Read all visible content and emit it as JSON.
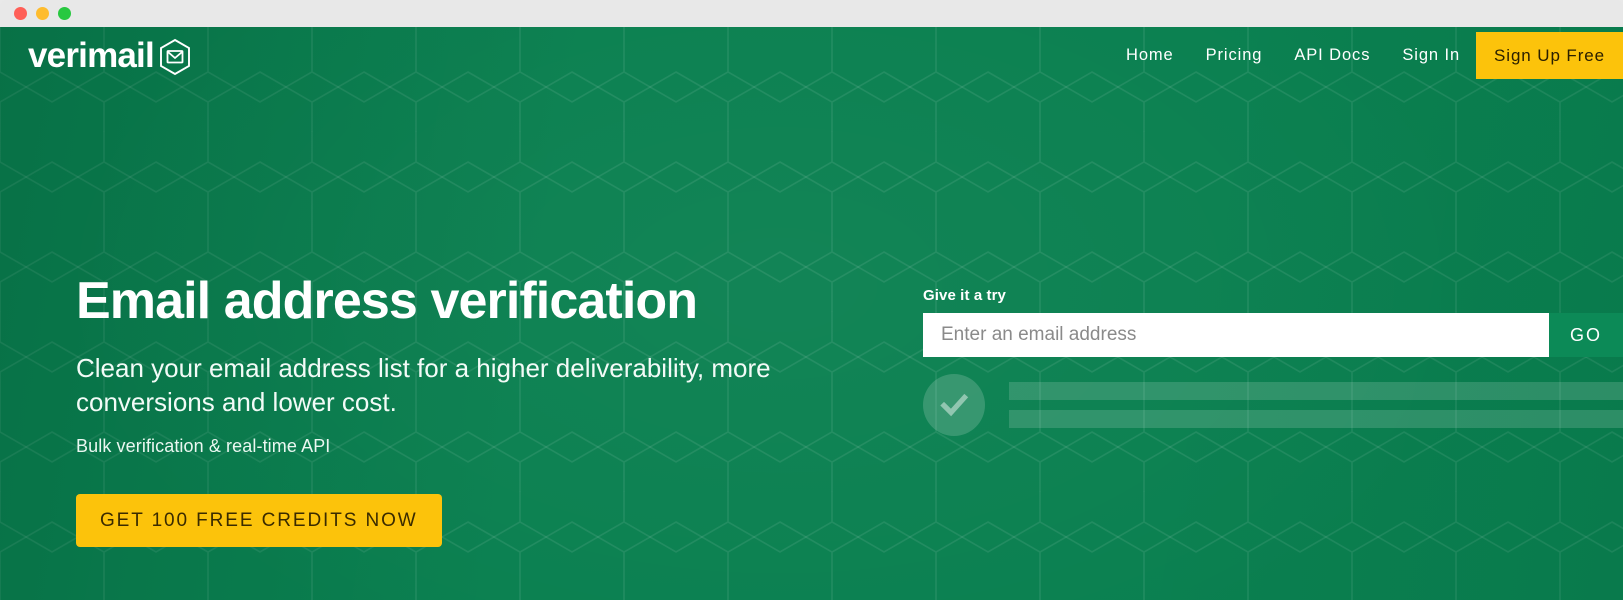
{
  "window": {
    "traffic_lights": [
      {
        "name": "close",
        "color": "#ff5f57"
      },
      {
        "name": "minimize",
        "color": "#febc2e"
      },
      {
        "name": "zoom",
        "color": "#28c840"
      }
    ]
  },
  "theme": {
    "background_green": "#0a8050",
    "accent_yellow": "#fcc30b",
    "go_button_green": "#0c8a57",
    "text_white": "#ffffff",
    "cta_text_dark": "#3a2b00"
  },
  "header": {
    "brand_name": "verimail",
    "brand_icon": "hexagon-envelope-icon",
    "nav_links": [
      {
        "label": "Home"
      },
      {
        "label": "Pricing"
      },
      {
        "label": "API Docs"
      },
      {
        "label": "Sign In"
      }
    ],
    "signup_button_label": "Sign Up Free"
  },
  "hero": {
    "heading": "Email address verification",
    "subheading": "Clean your email address list for a higher deliverability, more conversions and lower cost.",
    "tagline": "Bulk verification & real-time API",
    "cta_label": "GET 100 FREE CREDITS NOW"
  },
  "try_widget": {
    "label": "Give it a try",
    "input_placeholder": "Enter an email address",
    "input_value": "",
    "go_button_label": "GO",
    "result_icon": "check-circle-icon",
    "skeleton_line_count": 2
  }
}
